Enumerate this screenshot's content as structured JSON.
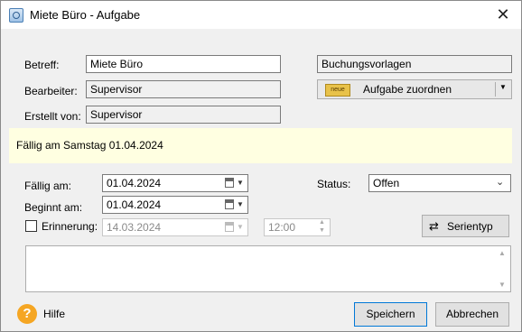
{
  "window": {
    "title": "Miete Büro - Aufgabe",
    "close_glyph": "✕"
  },
  "form": {
    "betreff_label": "Betreff:",
    "betreff_value": "Miete Büro",
    "bearbeiter_label": "Bearbeiter:",
    "bearbeiter_value": "Supervisor",
    "erstellt_label": "Erstellt von:",
    "erstellt_value": "Supervisor",
    "buchungsvorlagen_label": "Buchungsvorlagen",
    "aufgabe_zuordnen_label": "Aufgabe zuordnen",
    "aufgabe_zuordnen_icon_text": "neue"
  },
  "banner": {
    "text": "Fällig am Samstag 01.04.2024",
    "color": "#ffffe1"
  },
  "dates": {
    "faellig_label": "Fällig am:",
    "faellig_value": "01.04.2024",
    "beginnt_label": "Beginnt am:",
    "beginnt_value": "01.04.2024",
    "erinnerung_label": "Erinnerung:",
    "erinnerung_checked": false,
    "erinnerung_date": "14.03.2024",
    "erinnerung_time": "12:00"
  },
  "status": {
    "label": "Status:",
    "value": "Offen"
  },
  "serientyp_label": "Serientyp",
  "notes_value": "",
  "footer": {
    "help_icon": "?",
    "help_label": "Hilfe",
    "save_label": "Speichern",
    "cancel_label": "Abbrechen",
    "accent_color": "#0078d7"
  }
}
